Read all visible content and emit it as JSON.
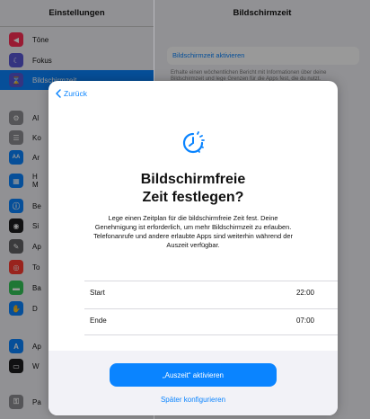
{
  "sidebar": {
    "title": "Einstellungen",
    "items": [
      {
        "label": "Töne",
        "icon": "speaker-icon",
        "color": "#ff2d55",
        "glyph": "◀"
      },
      {
        "label": "Fokus",
        "icon": "moon-icon",
        "color": "#5856d6",
        "glyph": "☾"
      },
      {
        "label": "Bildschirmzeit",
        "icon": "hourglass-icon",
        "color": "#5856d6",
        "glyph": "⌛",
        "selected": true
      },
      {
        "label": "Al",
        "icon": "gear-icon",
        "color": "#8e8e93",
        "glyph": "⚙"
      },
      {
        "label": "Ko",
        "icon": "switches-icon",
        "color": "#8e8e93",
        "glyph": "☰"
      },
      {
        "label": "Ar",
        "icon": "aa-icon",
        "color": "#0a84ff",
        "glyph": "AA"
      },
      {
        "label": "H\nM",
        "icon": "grid-icon",
        "color": "#0a84ff",
        "glyph": "▦"
      },
      {
        "label": "Be",
        "icon": "accessibility-icon",
        "color": "#0a84ff",
        "glyph": "ⓘ"
      },
      {
        "label": "Si",
        "icon": "siri-icon",
        "color": "#1c1c1e",
        "glyph": "◉"
      },
      {
        "label": "Ap",
        "icon": "pencil-icon",
        "color": "#636366",
        "glyph": "✎"
      },
      {
        "label": "To",
        "icon": "fingerprint-icon",
        "color": "#ff3b30",
        "glyph": "◎"
      },
      {
        "label": "Ba",
        "icon": "battery-icon",
        "color": "#34c759",
        "glyph": "▬"
      },
      {
        "label": "D",
        "icon": "hand-icon",
        "color": "#0a84ff",
        "glyph": "✋"
      },
      {
        "label": "Ap",
        "icon": "appstore-icon",
        "color": "#0a84ff",
        "glyph": "A"
      },
      {
        "label": "W",
        "icon": "wallet-icon",
        "color": "#1c1c1e",
        "glyph": "▭"
      },
      {
        "label": "Pa",
        "icon": "key-icon",
        "color": "#8e8e93",
        "glyph": "⚿"
      }
    ]
  },
  "detail": {
    "title": "Bildschirmzeit",
    "card_label": "Bildschirmzeit aktivieren",
    "description": "Erhalte einen wöchentlichen Bericht mit Informationen über deine Bildschirmzeit und lege Grenzen für die Apps fest, die du nutzt."
  },
  "sheet": {
    "back_label": "Zurück",
    "hero_icon": "downtime-icon",
    "heading_line1": "Bildschirmfreie",
    "heading_line2": "Zeit festlegen?",
    "body": "Lege einen Zeitplan für die bildschirmfreie Zeit fest. Deine Genehmigung ist erforderlich, um mehr Bildschirmzeit zu erlauben. Telefonanrufe und andere erlaubte Apps sind weiterhin während der Auszeit verfügbar.",
    "schedule": [
      {
        "label": "Start",
        "value": "22:00"
      },
      {
        "label": "Ende",
        "value": "07:00"
      }
    ],
    "primary_button": "„Auszeit“ aktivieren",
    "secondary_button": "Später konfigurieren"
  },
  "colors": {
    "accent": "#0a84ff",
    "background": "#f2f2f7"
  }
}
